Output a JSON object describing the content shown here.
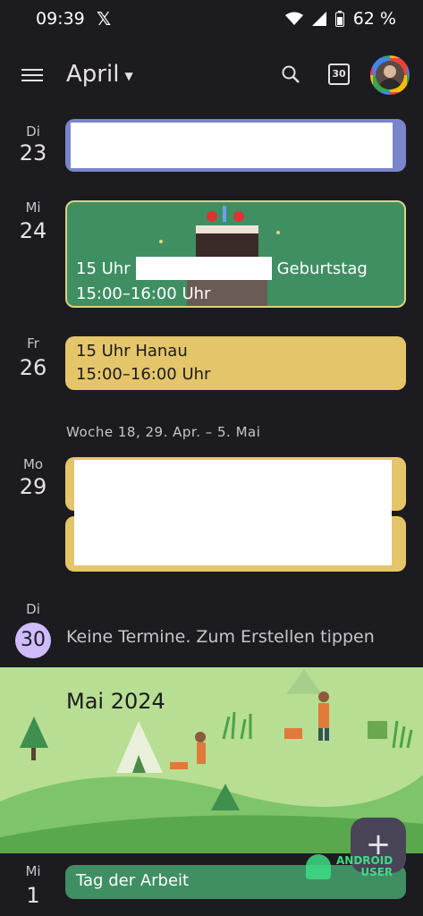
{
  "status_bar": {
    "time": "09:39",
    "battery": "62 %"
  },
  "app_bar": {
    "month": "April",
    "today_date": "30"
  },
  "days": [
    {
      "dow": "Di",
      "num": "23"
    },
    {
      "dow": "Mi",
      "num": "24"
    },
    {
      "dow": "Fr",
      "num": "26"
    },
    {
      "dow": "Mo",
      "num": "29"
    },
    {
      "dow": "Di",
      "num": "30"
    },
    {
      "dow": "Mi",
      "num": "1"
    }
  ],
  "events": {
    "birthday": {
      "title_prefix": "15 Uhr",
      "title_suffix": "Geburtstag",
      "time": "15:00–16:00 Uhr"
    },
    "hanau": {
      "title": "15 Uhr Hanau",
      "time": "15:00–16:00 Uhr"
    },
    "may1": {
      "title": "Tag der Arbeit"
    }
  },
  "week_label": "Woche 18, 29. Apr. – 5. Mai",
  "no_events_text": "Keine Termine. Zum Erstellen tippen",
  "month_banner": "Mai 2024",
  "fab_label": "+",
  "watermark": {
    "line1": "ANDROID",
    "line2": "USER"
  },
  "colors": {
    "lavender": "#7986cb",
    "sage": "#3f8f63",
    "banana": "#e4c56a",
    "today": "#cfbcff",
    "banner": "#b7de92"
  }
}
